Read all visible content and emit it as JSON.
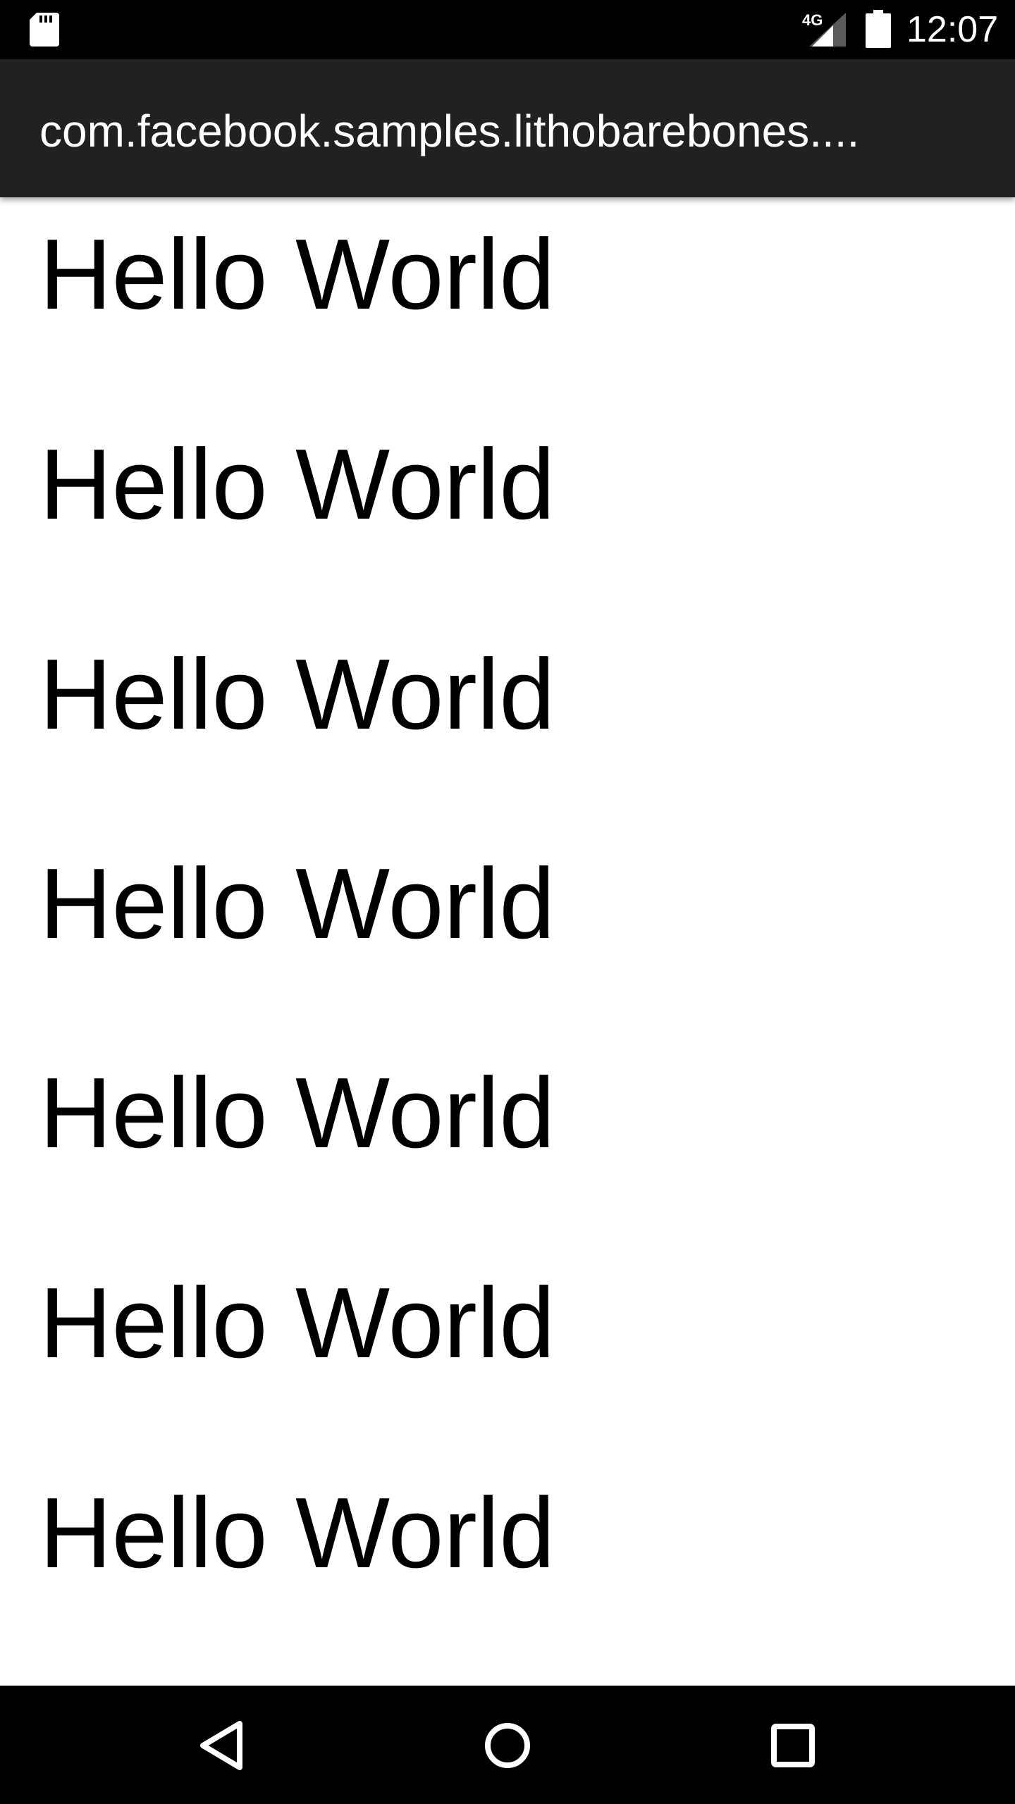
{
  "status_bar": {
    "network_type": "4G",
    "time": "12:07",
    "icons": [
      "sd-card-icon",
      "signal-icon",
      "battery-icon"
    ]
  },
  "app_bar": {
    "title": "com.facebook.samples.lithobarebones...."
  },
  "list": {
    "items": [
      "Hello World",
      "Hello World",
      "Hello World",
      "Hello World",
      "Hello World",
      "Hello World",
      "Hello World"
    ]
  },
  "nav_bar": {
    "icons": [
      "back-icon",
      "home-icon",
      "recents-icon"
    ]
  }
}
